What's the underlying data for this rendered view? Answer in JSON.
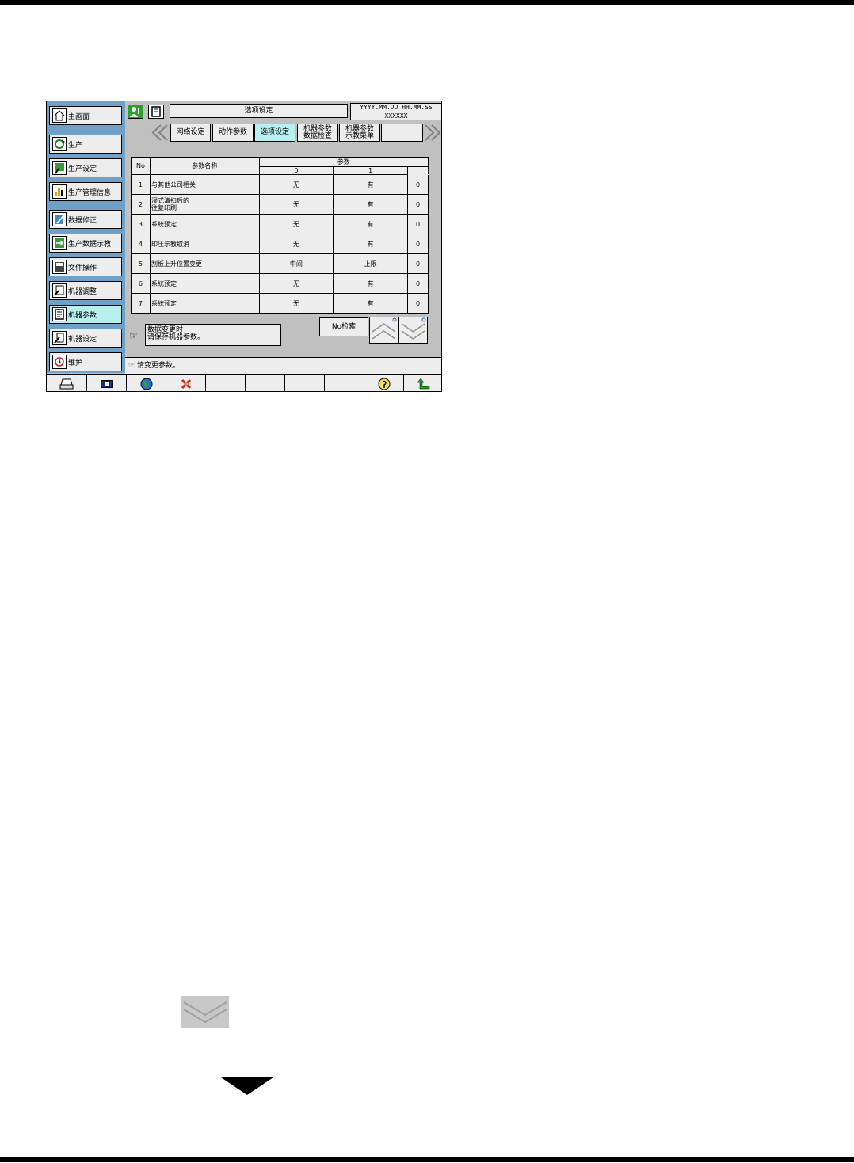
{
  "header": {
    "title": "选项设定",
    "datetime": "YYYY.MM.DD HH.MM.SS",
    "machine_id": "XXXXXX"
  },
  "sidebar": {
    "items": [
      {
        "label": "主画面",
        "icon": "home-icon"
      },
      {
        "label": "生产",
        "icon": "production-icon"
      },
      {
        "label": "生产设定",
        "icon": "production-setting-icon"
      },
      {
        "label": "生产管理信息",
        "icon": "chart-icon"
      },
      {
        "label": "数据修正",
        "icon": "data-edit-icon"
      },
      {
        "label": "生产数据示教",
        "icon": "teach-icon"
      },
      {
        "label": "文件操作",
        "icon": "disk-icon"
      },
      {
        "label": "机器调整",
        "icon": "machine-adjust-icon"
      },
      {
        "label": "机器参数",
        "icon": "machine-param-icon",
        "active": true
      },
      {
        "label": "机器设定",
        "icon": "machine-setting-icon"
      },
      {
        "label": "维护",
        "icon": "maintenance-icon"
      }
    ]
  },
  "tabs": [
    {
      "label": "网络设定"
    },
    {
      "label": "动作参数"
    },
    {
      "label": "选项设定",
      "active": true
    },
    {
      "label": "机器参数\n数据检查"
    },
    {
      "label": "机器参数\n示教菜单"
    },
    {
      "label": ""
    }
  ],
  "table": {
    "col_no": "No",
    "col_name": "参数名称",
    "col_param": "参数",
    "sub_0": "0",
    "sub_1": "1",
    "rows": [
      {
        "no": "1",
        "name": "与其他公司相关",
        "v0": "无",
        "v1": "有",
        "val": "0"
      },
      {
        "no": "2",
        "name": "湿式清扫后的\n往复印刷",
        "v0": "无",
        "v1": "有",
        "val": "0"
      },
      {
        "no": "3",
        "name": "系統预定",
        "v0": "无",
        "v1": "有",
        "val": "0"
      },
      {
        "no": "4",
        "name": "印压示教取消",
        "v0": "无",
        "v1": "有",
        "val": "0"
      },
      {
        "no": "5",
        "name": "刮板上升位置变更",
        "v0": "中间",
        "v1": "上限",
        "val": "0"
      },
      {
        "no": "6",
        "name": "系統预定",
        "v0": "无",
        "v1": "有",
        "val": "0"
      },
      {
        "no": "7",
        "name": "系統预定",
        "v0": "无",
        "v1": "有",
        "val": "0"
      }
    ]
  },
  "message": "数据变更时\n请保存机器参数。",
  "no_search": "No检索",
  "status": "请变更参数。",
  "colors": {
    "sidebar": "#6fa0c8",
    "active": "#b8f0f0",
    "panel": "#c0c0c0",
    "button": "#ededed"
  }
}
